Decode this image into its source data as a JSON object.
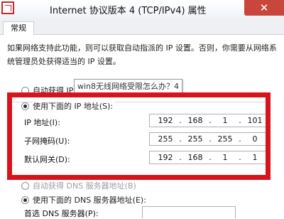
{
  "window": {
    "title": "Internet 协议版本 4 (TCP/IPv4) 属性",
    "close_glyph": "✕"
  },
  "tabs": [
    {
      "label": "常规"
    }
  ],
  "description": "如果网络支持此功能，则可以获取自动指派的 IP 设置。否则，你需要从网络系统管理员处获得适当的 IP 设置。",
  "ip_auto_option": "自动获得 IP 地址(O)",
  "tooltip": "win8无线网络受限怎么办？4",
  "ip_manual_option": "使用下面的 IP 地址(S):",
  "fields": {
    "ip_address": {
      "label": "IP 地址(I):",
      "octets": [
        "192",
        "168",
        "1",
        "101"
      ]
    },
    "subnet_mask": {
      "label": "子网掩码(U):",
      "octets": [
        "255",
        "255",
        "255",
        "0"
      ]
    },
    "gateway": {
      "label": "默认网关(D):",
      "octets": [
        "192",
        "168",
        "1",
        "1"
      ]
    }
  },
  "dns_auto_option": "自动获得 DNS 服务器地址(B)",
  "dns_manual_option": "使用下面的 DNS 服务器地址(E):",
  "preferred_dns_label": "首选 DNS 服务器(P):",
  "highlight_color": "#d7141b",
  "icons": {
    "window": "network-adapter-icon"
  }
}
